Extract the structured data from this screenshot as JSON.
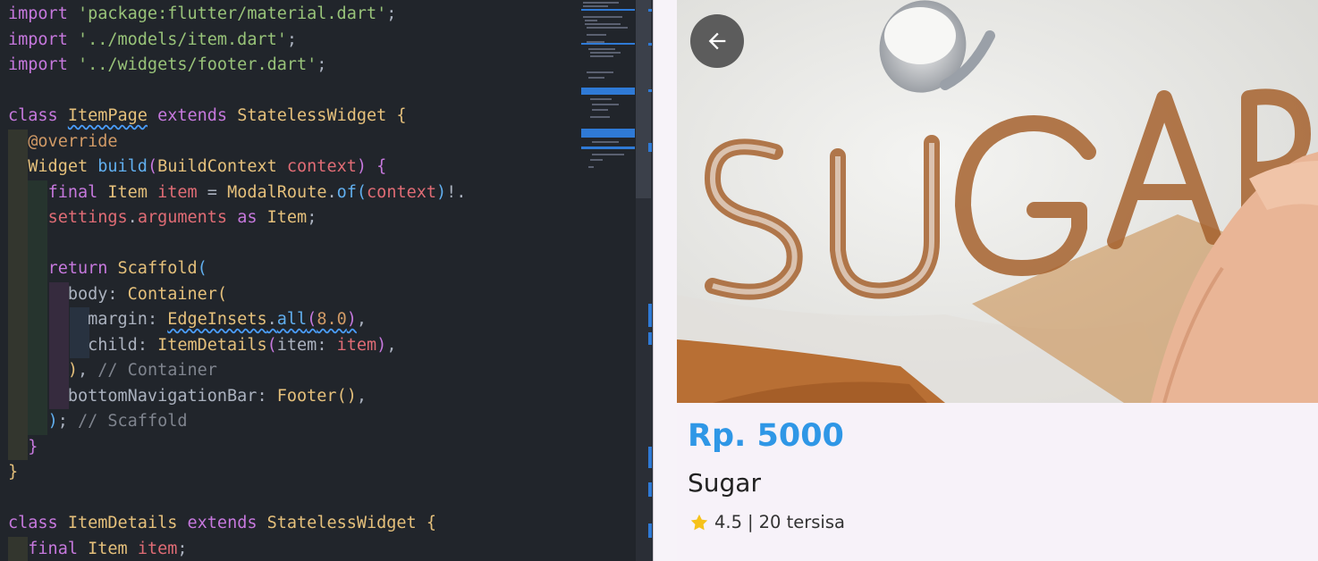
{
  "code_lines": [
    {
      "indent": 0,
      "html": "<span class='kw'>import</span> <span class='str'>'package:flutter/material.dart'</span>;"
    },
    {
      "indent": 0,
      "html": "<span class='kw'>import</span> <span class='str'>'../models/item.dart'</span>;"
    },
    {
      "indent": 0,
      "html": "<span class='kw'>import</span> <span class='str'>'../widgets/footer.dart'</span>;"
    },
    {
      "indent": 0,
      "html": ""
    },
    {
      "indent": 0,
      "html": "<span class='kw'>class</span> <span class='cls squig'>ItemPage</span> <span class='kw'>extends</span> <span class='cls'>StatelessWidget</span> <span class='br1'>{</span>"
    },
    {
      "indent": 1,
      "html": "  <span class='ann'>@override</span>"
    },
    {
      "indent": 1,
      "html": "  <span class='cls'>Widget</span> <span class='fn'>build</span><span class='br2'>(</span><span class='cls'>BuildContext</span> <span class='var'>context</span><span class='br2'>)</span> <span class='br2'>{</span>"
    },
    {
      "indent": 2,
      "html": "    <span class='kw'>final</span> <span class='cls'>Item</span> <span class='var'>item</span> = <span class='cls'>ModalRoute</span>.<span class='fn'>of</span><span class='br3'>(</span><span class='var'>context</span><span class='br3'>)</span>!."
    },
    {
      "indent": 2,
      "html": "    <span class='var'>settings</span>.<span class='var'>arguments</span> <span class='kw'>as</span> <span class='cls'>Item</span>;"
    },
    {
      "indent": 2,
      "html": ""
    },
    {
      "indent": 2,
      "html": "    <span class='kw'>return</span> <span class='cls'>Scaffold</span><span class='br3'>(</span>"
    },
    {
      "indent": 3,
      "html": "      <span class='prop'>body</span>: <span class='cls'>Container</span><span class='br1'>(</span>"
    },
    {
      "indent": 4,
      "html": "        <span class='prop'>margin</span>: <span class='cls squig'>EdgeInsets</span><span class='squig'>.</span><span class='fn squig'>all</span><span class='br2 squig'>(</span><span class='num squig'>8.0</span><span class='br2 squig'>)</span>,"
    },
    {
      "indent": 4,
      "html": "        <span class='prop'>child</span>: <span class='cls'>ItemDetails</span><span class='br2'>(</span><span class='prop'>item</span>: <span class='var'>item</span><span class='br2'>)</span>,"
    },
    {
      "indent": 3,
      "html": "      <span class='br1'>)</span>, <span class='cmt'>// Container</span>"
    },
    {
      "indent": 3,
      "html": "      <span class='prop'>bottomNavigationBar</span>: <span class='cls'>Footer</span><span class='br1'>()</span>,"
    },
    {
      "indent": 2,
      "html": "    <span class='br3'>)</span>; <span class='cmt'>// Scaffold</span>"
    },
    {
      "indent": 1,
      "html": "  <span class='br2'>}</span>"
    },
    {
      "indent": 0,
      "html": "<span class='br1'>}</span>"
    },
    {
      "indent": 0,
      "html": ""
    },
    {
      "indent": 0,
      "html": "<span class='kw'>class</span> <span class='cls'>ItemDetails</span> <span class='kw'>extends</span> <span class='cls'>StatelessWidget</span> <span class='br1'>{</span>"
    },
    {
      "indent": 1,
      "html": "  <span class='kw'>final</span> <span class='cls'>Item</span> <span class='var'>item</span>;"
    }
  ],
  "app": {
    "hero_text": "SUGAR",
    "price": "Rp. 5000",
    "name": "Sugar",
    "rating": "4.5",
    "separator": "|",
    "stock": "20 tersisa",
    "colors": {
      "price": "#2f97e6",
      "star": "#f6c21a",
      "background": "#f7f2f9"
    },
    "icons": {
      "back": "arrow-back-icon",
      "star": "star-icon"
    }
  }
}
